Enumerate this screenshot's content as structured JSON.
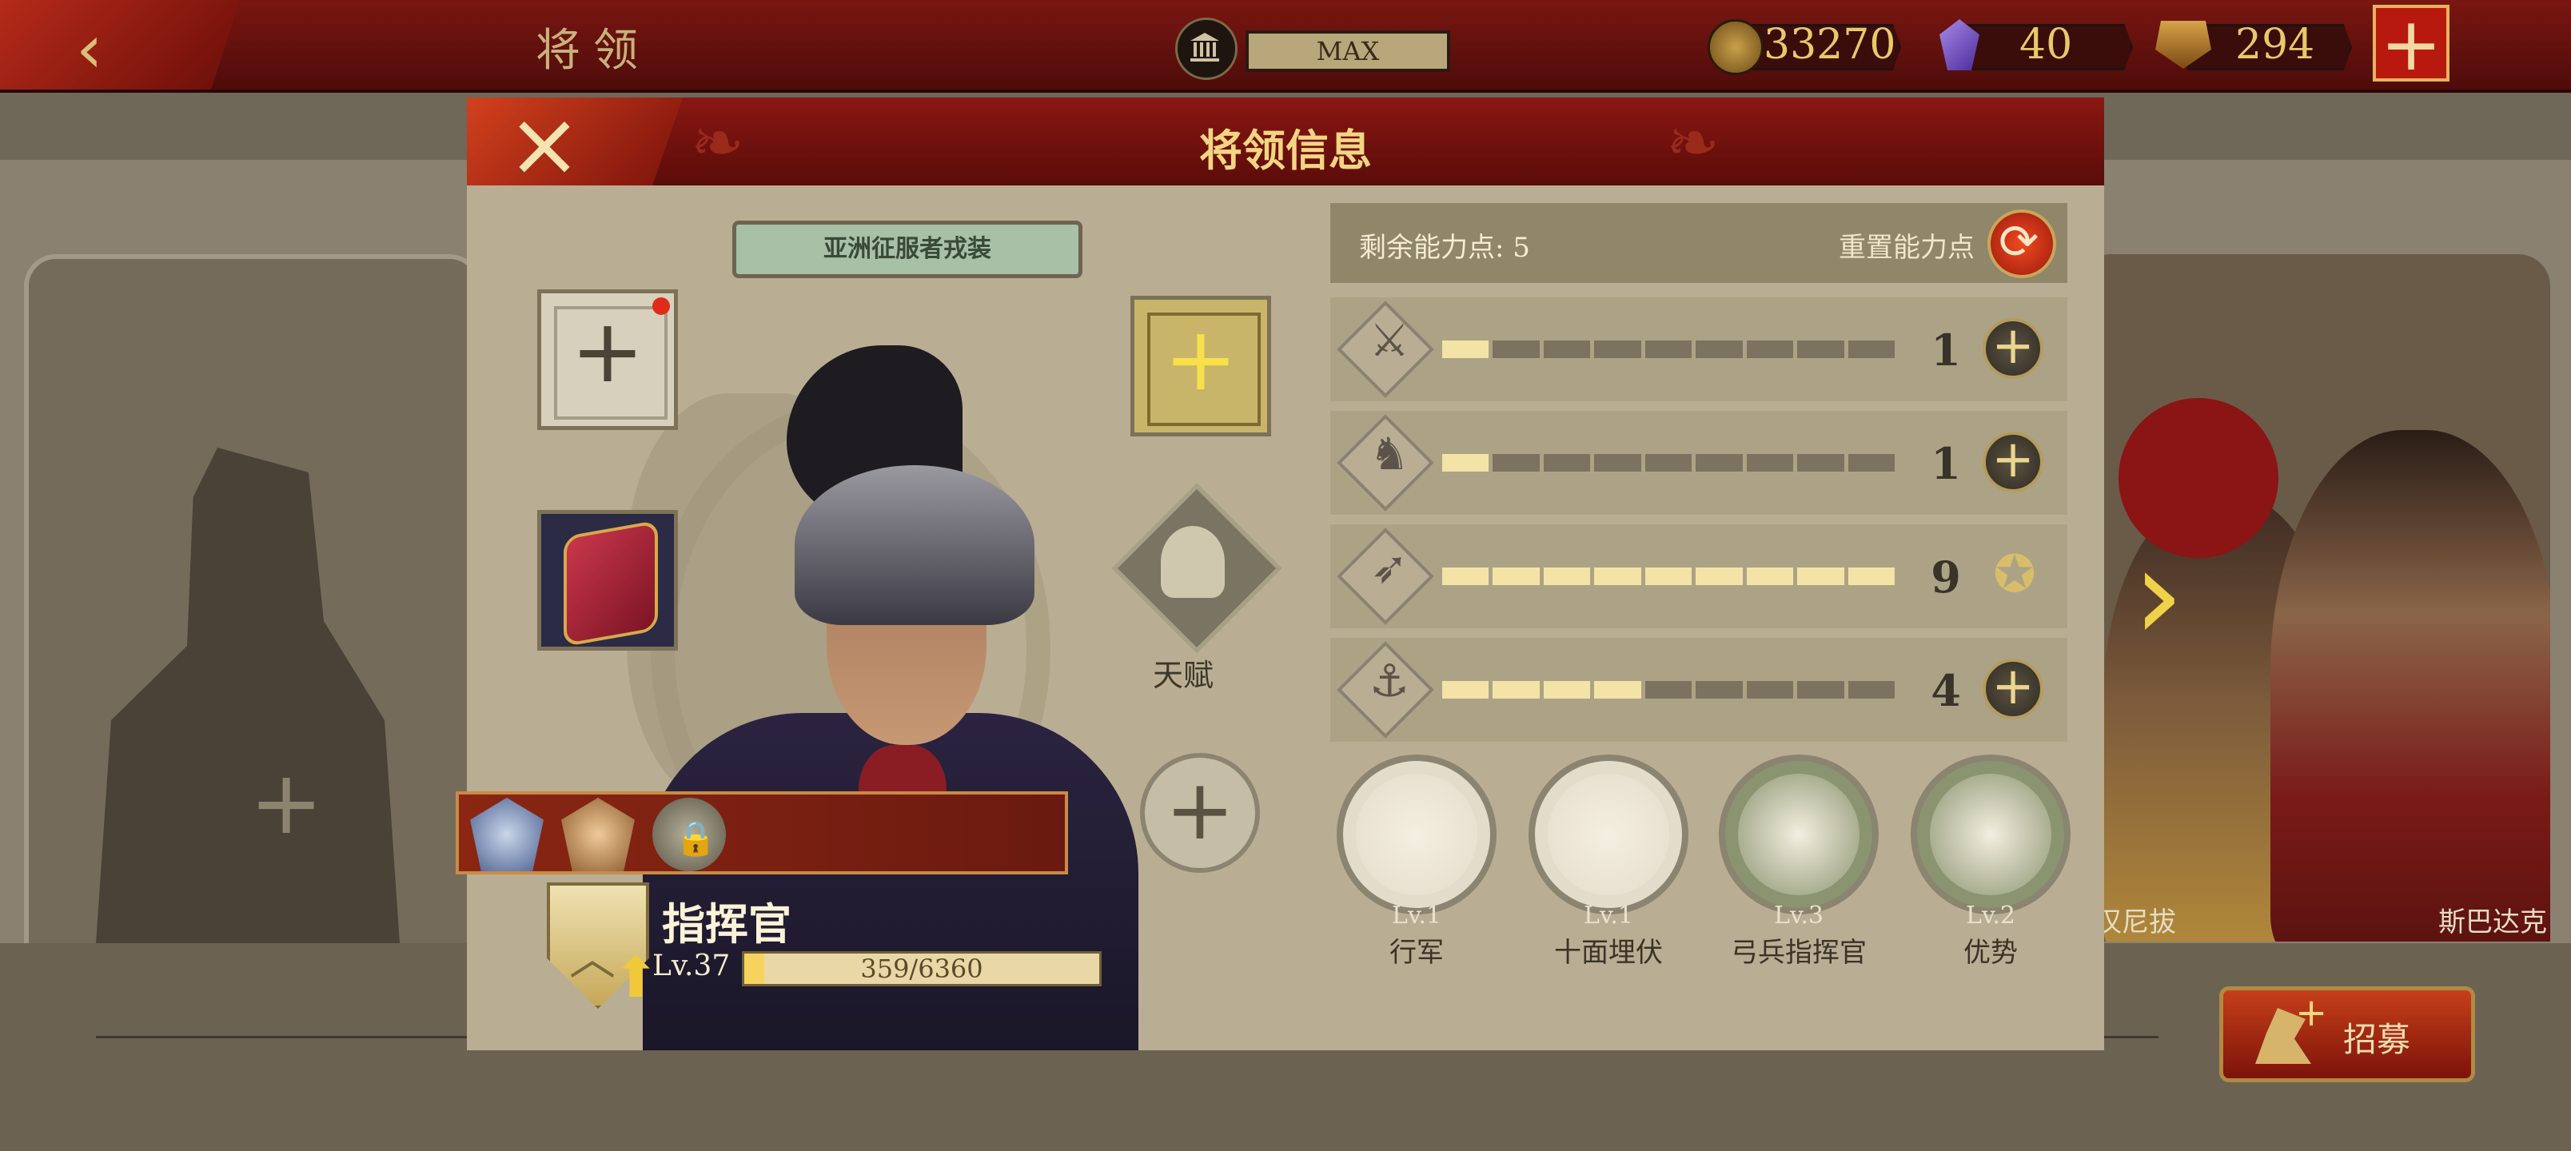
{
  "topbar": {
    "title": "将领",
    "building_level": "MAX",
    "resources": {
      "coins": "33270",
      "gems": "40",
      "spqr": "294"
    }
  },
  "background": {
    "heroes": [
      "汉尼拔",
      "斯巴达克"
    ],
    "recruit_label": "招募"
  },
  "modal": {
    "title": "将领信息",
    "skin_name": "亚洲征服者戎装",
    "talent_label": "天赋",
    "rank_name": "指挥官",
    "level": "Lv.37",
    "xp_text": "359/6360",
    "xp_fraction": 0.0564,
    "points": {
      "label": "剩余能力点: 5",
      "reset_label": "重置能力点"
    },
    "stats": [
      {
        "icon": "sword-icon",
        "value": "1",
        "filled": 1,
        "max": 9,
        "maxed": false
      },
      {
        "icon": "horse-icon",
        "value": "1",
        "filled": 1,
        "max": 9,
        "maxed": false
      },
      {
        "icon": "bow-icon",
        "value": "9",
        "filled": 9,
        "max": 9,
        "maxed": true
      },
      {
        "icon": "anchor-icon",
        "value": "4",
        "filled": 4,
        "max": 9,
        "maxed": false
      }
    ],
    "skills": [
      {
        "level": "Lv.1",
        "name": "行军",
        "color": "#e4dccb"
      },
      {
        "level": "Lv.1",
        "name": "十面埋伏",
        "color": "#e4dccb"
      },
      {
        "level": "Lv.3",
        "name": "弓兵指挥官",
        "color": "#8a9470"
      },
      {
        "level": "Lv.2",
        "name": "优势",
        "color": "#8a9470"
      }
    ]
  }
}
